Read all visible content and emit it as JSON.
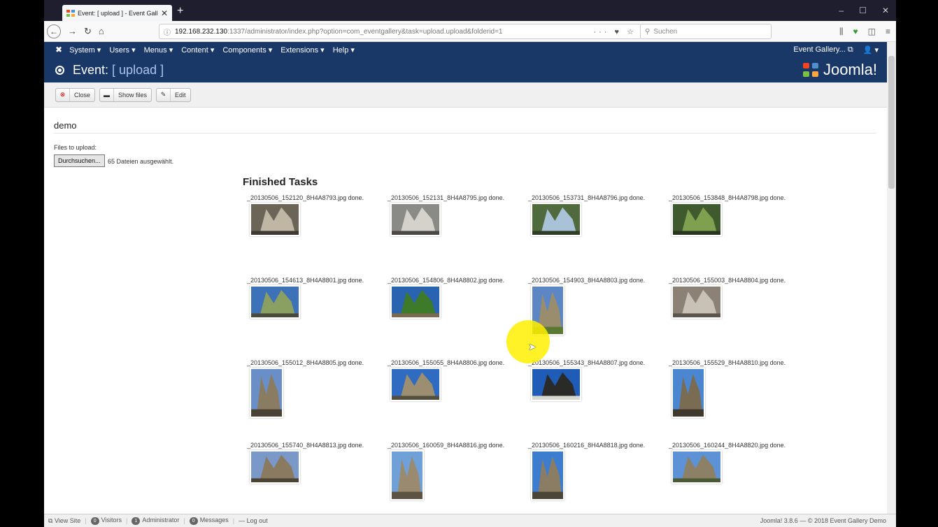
{
  "browser": {
    "tab_title": "Event: [ upload ] - Event Galler",
    "url_host": "192.168.232.130",
    "url_rest": ":1337/administrator/index.php?option=com_eventgallery&task=upload.upload&folderid=1",
    "search_placeholder": "Suchen"
  },
  "admin_menu": {
    "items": [
      "System ▾",
      "Users ▾",
      "Menus ▾",
      "Content ▾",
      "Components ▾",
      "Extensions ▾",
      "Help ▾"
    ],
    "site_link": "Event Gallery...",
    "user": "▾"
  },
  "header": {
    "prefix": "Event:",
    "subtitle": "[ upload ]",
    "brand": "Joomla!"
  },
  "toolbar": {
    "close": "Close",
    "show_files": "Show files",
    "edit": "Edit"
  },
  "content": {
    "folder_name": "demo",
    "files_label": "Files to upload:",
    "browse_label": "Durchsuchen...",
    "selection": "65 Dateien ausgewählt.",
    "finished_title": "Finished Tasks"
  },
  "tasks": [
    {
      "name": "_20130506_152120_8H4A8793.jpg done.",
      "orientation": "landscape",
      "colors": [
        "#6b6558",
        "#bfb6a3",
        "#3e3a33"
      ]
    },
    {
      "name": "_20130506_152131_8H4A8795.jpg done.",
      "orientation": "landscape",
      "colors": [
        "#8a8a86",
        "#d4d2cb",
        "#4b4945"
      ]
    },
    {
      "name": "_20130506_153731_8H4A8796.jpg done.",
      "orientation": "landscape",
      "colors": [
        "#4f6a3c",
        "#a9c2d8",
        "#2f3c26"
      ]
    },
    {
      "name": "_20130506_153848_8H4A8798.jpg done.",
      "orientation": "landscape",
      "colors": [
        "#3f5a2e",
        "#7fa14f",
        "#2a3520"
      ]
    },
    {
      "name": "_20130506_154613_8H4A8801.jpg done.",
      "orientation": "landscape",
      "colors": [
        "#3d71b8",
        "#8aa063",
        "#4a4a3c"
      ]
    },
    {
      "name": "_20130506_154806_8H4A8802.jpg done.",
      "orientation": "landscape",
      "colors": [
        "#2a64b0",
        "#3d7a2a",
        "#7a6a50"
      ]
    },
    {
      "name": "_20130506_154903_8H4A8803.jpg done.",
      "orientation": "portrait",
      "colors": [
        "#5c86c4",
        "#9a8d6d",
        "#5a7a34"
      ]
    },
    {
      "name": "_20130506_155003_8H4A8804.jpg done.",
      "orientation": "landscape",
      "colors": [
        "#8b8275",
        "#c8c1b5",
        "#5b564d"
      ]
    },
    {
      "name": "_20130506_155012_8H4A8805.jpg done.",
      "orientation": "portrait",
      "colors": [
        "#6a8fc8",
        "#8a7c62",
        "#4a4234"
      ]
    },
    {
      "name": "_20130506_155055_8H4A8806.jpg done.",
      "orientation": "landscape",
      "colors": [
        "#2f6bc0",
        "#9c8e70",
        "#54503f"
      ]
    },
    {
      "name": "_20130506_155343_8H4A8807.jpg done.",
      "orientation": "landscape",
      "colors": [
        "#1f5cb8",
        "#2a2a28",
        "#d8d8d2"
      ]
    },
    {
      "name": "_20130506_155529_8H4A8810.jpg done.",
      "orientation": "portrait",
      "colors": [
        "#4b86d0",
        "#7a6c52",
        "#3e382d"
      ]
    },
    {
      "name": "_20130506_155740_8H4A8813.jpg done.",
      "orientation": "landscape",
      "colors": [
        "#7a98c8",
        "#8a7a60",
        "#4c4335"
      ]
    },
    {
      "name": "_20130506_160059_8H4A8816.jpg done.",
      "orientation": "portrait",
      "colors": [
        "#6fa0d8",
        "#9a8b70",
        "#5c5343"
      ]
    },
    {
      "name": "_20130506_160216_8H4A8818.jpg done.",
      "orientation": "portrait",
      "colors": [
        "#3d7dcf",
        "#8a7d64",
        "#4a4537"
      ]
    },
    {
      "name": "_20130506_160244_8H4A8820.jpg done.",
      "orientation": "landscape",
      "colors": [
        "#5e92d6",
        "#8c8067",
        "#4a5a32"
      ]
    }
  ],
  "statusbar": {
    "view_site": "View Site",
    "visitors_count": "0",
    "visitors": "Visitors",
    "admin_count": "1",
    "administrator": "Administrator",
    "messages_count": "0",
    "messages": "Messages",
    "logout": "Log out",
    "version": "Joomla! 3.8.6 — © 2018 Event Gallery Demo"
  }
}
